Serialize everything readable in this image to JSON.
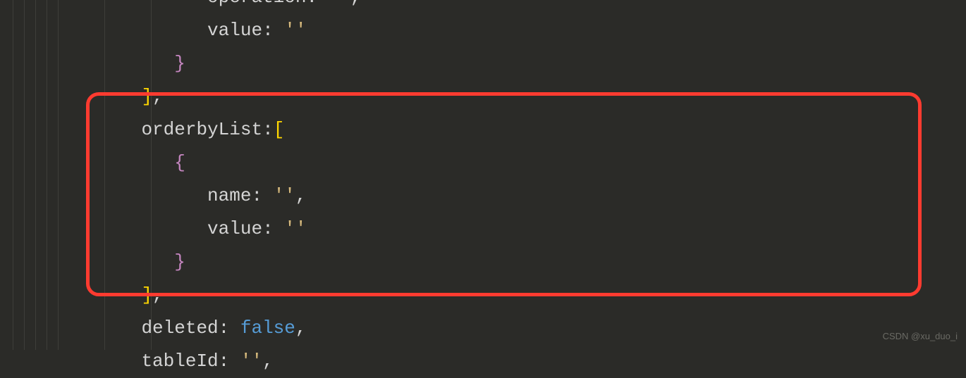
{
  "code": {
    "lines": [
      {
        "indent": 5,
        "tokens": [
          {
            "t": "prop",
            "v": "operation"
          },
          {
            "t": "punct",
            "v": ": "
          },
          {
            "t": "string",
            "v": "''"
          },
          {
            "t": "punct",
            "v": ","
          }
        ]
      },
      {
        "indent": 5,
        "tokens": [
          {
            "t": "prop",
            "v": "value"
          },
          {
            "t": "punct",
            "v": ": "
          },
          {
            "t": "string",
            "v": "''"
          }
        ]
      },
      {
        "indent": 4,
        "tokens": [
          {
            "t": "brace",
            "v": "}"
          }
        ]
      },
      {
        "indent": 3,
        "tokens": [
          {
            "t": "sqbracket",
            "v": "]"
          },
          {
            "t": "punct",
            "v": ","
          }
        ]
      },
      {
        "indent": 3,
        "tokens": [
          {
            "t": "prop",
            "v": "orderbyList"
          },
          {
            "t": "punct",
            "v": ":"
          },
          {
            "t": "sqbracket",
            "v": "["
          }
        ]
      },
      {
        "indent": 4,
        "tokens": [
          {
            "t": "brace",
            "v": "{"
          }
        ]
      },
      {
        "indent": 5,
        "tokens": [
          {
            "t": "prop",
            "v": "name"
          },
          {
            "t": "punct",
            "v": ": "
          },
          {
            "t": "string",
            "v": "''"
          },
          {
            "t": "punct",
            "v": ","
          }
        ]
      },
      {
        "indent": 5,
        "tokens": [
          {
            "t": "prop",
            "v": "value"
          },
          {
            "t": "punct",
            "v": ": "
          },
          {
            "t": "string",
            "v": "''"
          }
        ]
      },
      {
        "indent": 4,
        "tokens": [
          {
            "t": "brace",
            "v": "}"
          }
        ]
      },
      {
        "indent": 3,
        "tokens": [
          {
            "t": "sqbracket",
            "v": "]"
          },
          {
            "t": "punct",
            "v": ","
          }
        ]
      },
      {
        "indent": 3,
        "tokens": [
          {
            "t": "prop",
            "v": "deleted"
          },
          {
            "t": "punct",
            "v": ": "
          },
          {
            "t": "bool",
            "v": "false"
          },
          {
            "t": "punct",
            "v": ","
          }
        ]
      },
      {
        "indent": 3,
        "tokens": [
          {
            "t": "prop",
            "v": "tableId"
          },
          {
            "t": "punct",
            "v": ": "
          },
          {
            "t": "string",
            "v": "''"
          },
          {
            "t": "punct",
            "v": ","
          }
        ]
      }
    ]
  },
  "watermark": "CSDN @xu_duo_i",
  "guides": [
    18,
    34,
    50,
    66,
    82,
    148,
    214
  ]
}
